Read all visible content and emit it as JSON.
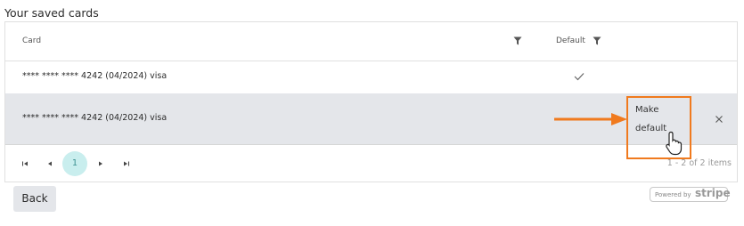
{
  "page": {
    "title": "Your saved cards"
  },
  "grid": {
    "columns": [
      {
        "label": "Card",
        "filterable": true
      },
      {
        "label": "Default",
        "filterable": true
      }
    ],
    "rows": [
      {
        "card": "**** **** **** 4242 (04/2024) visa",
        "is_default": true
      },
      {
        "card": "**** **** **** 4242 (04/2024) visa",
        "is_default": false,
        "action_label": "Make\ndefault"
      }
    ],
    "pager": {
      "current_page": "1",
      "info": "1 - 2 of 2 items"
    }
  },
  "footer": {
    "back_label": "Back",
    "stripe_powered_by": "Powered by",
    "stripe_wordmark": "stripe"
  },
  "colors": {
    "highlight": "#f07a1e",
    "selected_row": "#e4e6ea",
    "active_page": "#c9eeee"
  }
}
